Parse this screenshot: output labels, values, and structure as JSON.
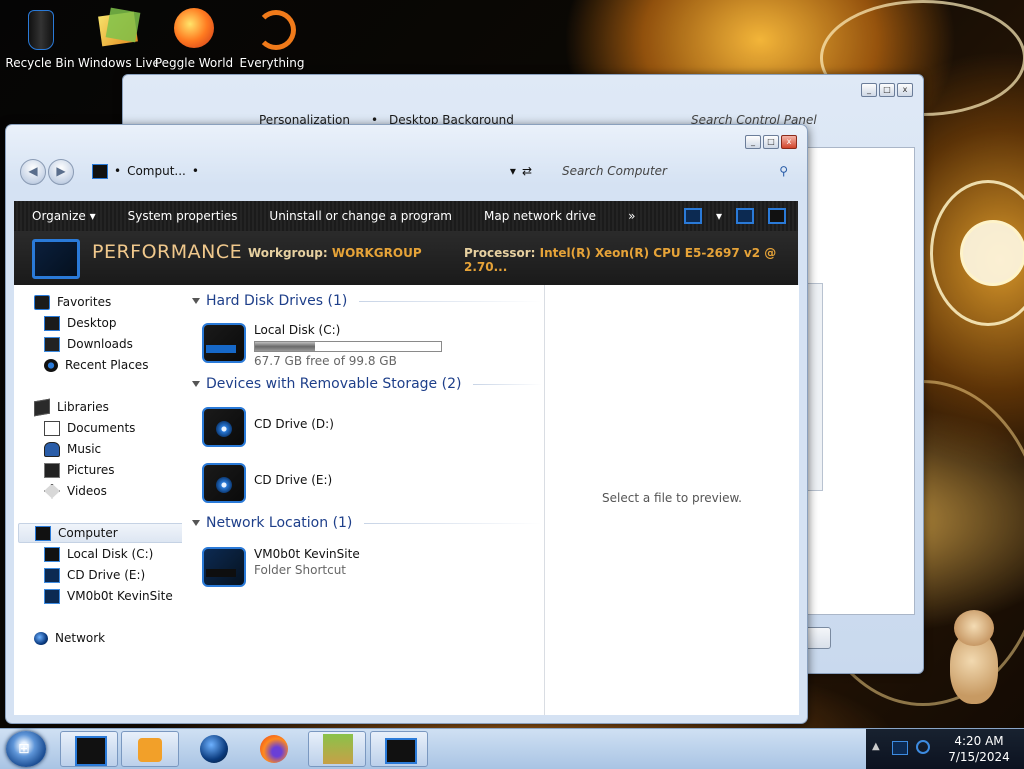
{
  "desktop": {
    "icons": [
      {
        "label": "Recycle Bin",
        "icon": "recycle-bin-icon"
      },
      {
        "label": "Windows Live Ma",
        "icon": "windows-live-mail-icon"
      },
      {
        "label": "Peggle World",
        "icon": "peggle-world-icon"
      },
      {
        "label": "Everything",
        "icon": "everything-search-icon"
      }
    ]
  },
  "bg_window": {
    "address": [
      "Personalization",
      "Desktop Background"
    ],
    "search_placeholder": "Search Control Panel"
  },
  "explorer": {
    "address": {
      "crumb": "Comput..."
    },
    "search_placeholder": "Search Computer",
    "toolbar": {
      "items": [
        "Organize",
        "System properties",
        "Uninstall or change a program",
        "Map network drive"
      ],
      "overflow": "»"
    },
    "details": {
      "name": "PERFORMANCE",
      "workgroup_label": "Workgroup:",
      "workgroup_value": "WORKGROUP",
      "processor_label": "Processor:",
      "processor_value": "Intel(R) Xeon(R) CPU E5-2697 v2 @ 2.70..."
    },
    "nav": {
      "favorites": {
        "label": "Favorites",
        "items": [
          "Desktop",
          "Downloads",
          "Recent Places"
        ]
      },
      "libraries": {
        "label": "Libraries",
        "items": [
          "Documents",
          "Music",
          "Pictures",
          "Videos"
        ]
      },
      "computer": {
        "label": "Computer",
        "items": [
          "Local Disk (C:)",
          "CD Drive (E:)",
          "VM0b0t KevinSite"
        ]
      },
      "network": {
        "label": "Network"
      }
    },
    "groups": {
      "hdd": {
        "title": "Hard Disk Drives (1)",
        "items": [
          {
            "name": "Local Disk (C:)",
            "free_text": "67.7 GB free of 99.8 GB",
            "used_fraction": 0.32
          }
        ]
      },
      "removable": {
        "title": "Devices with Removable Storage (2)",
        "items": [
          {
            "name": "CD Drive (D:)"
          },
          {
            "name": "CD Drive (E:)"
          }
        ]
      },
      "network": {
        "title": "Network Location (1)",
        "items": [
          {
            "name": "VM0b0t KevinSite",
            "sub": "Folder Shortcut"
          }
        ]
      }
    },
    "preview_text": "Select a file to preview."
  },
  "taskbar": {
    "clock_time": "4:20 AM",
    "clock_date": "7/15/2024",
    "pinned": [
      "explorer-icon",
      "media-player-icon",
      "globe-icon",
      "firefox-icon",
      "box-app-icon",
      "computer-icon"
    ]
  },
  "colors": {
    "accent": "#2a7ad8",
    "band_text": "#e6a338",
    "group_title": "#1e3f8a"
  }
}
